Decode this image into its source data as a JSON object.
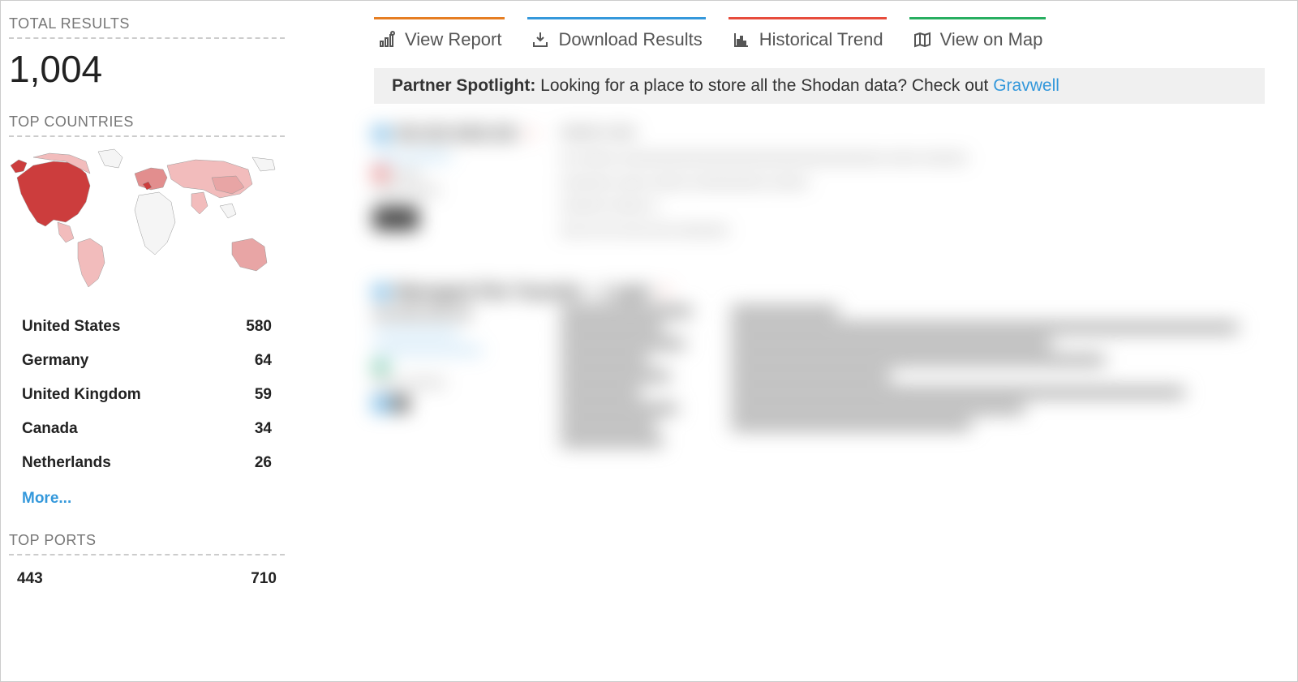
{
  "sidebar": {
    "total_results_label": "TOTAL RESULTS",
    "total_results_value": "1,004",
    "top_countries_label": "TOP COUNTRIES",
    "countries": [
      {
        "name": "United States",
        "count": "580"
      },
      {
        "name": "Germany",
        "count": "64"
      },
      {
        "name": "United Kingdom",
        "count": "59"
      },
      {
        "name": "Canada",
        "count": "34"
      },
      {
        "name": "Netherlands",
        "count": "26"
      }
    ],
    "more_label": "More...",
    "top_ports_label": "TOP PORTS",
    "ports": [
      {
        "port": "443",
        "count": "710"
      }
    ]
  },
  "actions": {
    "view_report": "View Report",
    "download_results": "Download Results",
    "historical_trend": "Historical Trend",
    "view_on_map": "View on Map"
  },
  "spotlight": {
    "label": "Partner Spotlight:",
    "text": " Looking for a place to store all the Shodan data? Check out ",
    "link_text": "Gravwell"
  },
  "blurred": {
    "r1_title": "XX.XX.XXX.XX",
    "r1_sub": "xxxxx.xxxxxxxx",
    "r1_loc1": "xxxxx",
    "r1_loc2": "xxxxx xxxxxx",
    "r1_tag": "xxx",
    "r1_body1": "XXXXX X XXX",
    "r1_body2": "XX XXXXX   XXXXXXXXXXXXXXXXXXXXXXXXXXXXXXXXXXX  XXXX  XXXXXX",
    "r1_body3": "XXXXXXX  XXXX  XXXXX XXXXXXXXXX XXXXX",
    "r1_body4": "XXXXXX XXXXX X",
    "r1_body5": "XXX  XX  XX XXX XXX XXXXXXX",
    "r2_title": "Managed File Transfer – Login",
    "r2_ip": "XX.XXX.XXX.XX",
    "r2_sub": "xxxxxxxxxxxxxxx",
    "r2_sub2": "xxxxxxxxxxxxxxxxxxx",
    "r2_loc": "xxxxx xxxxxxx"
  }
}
